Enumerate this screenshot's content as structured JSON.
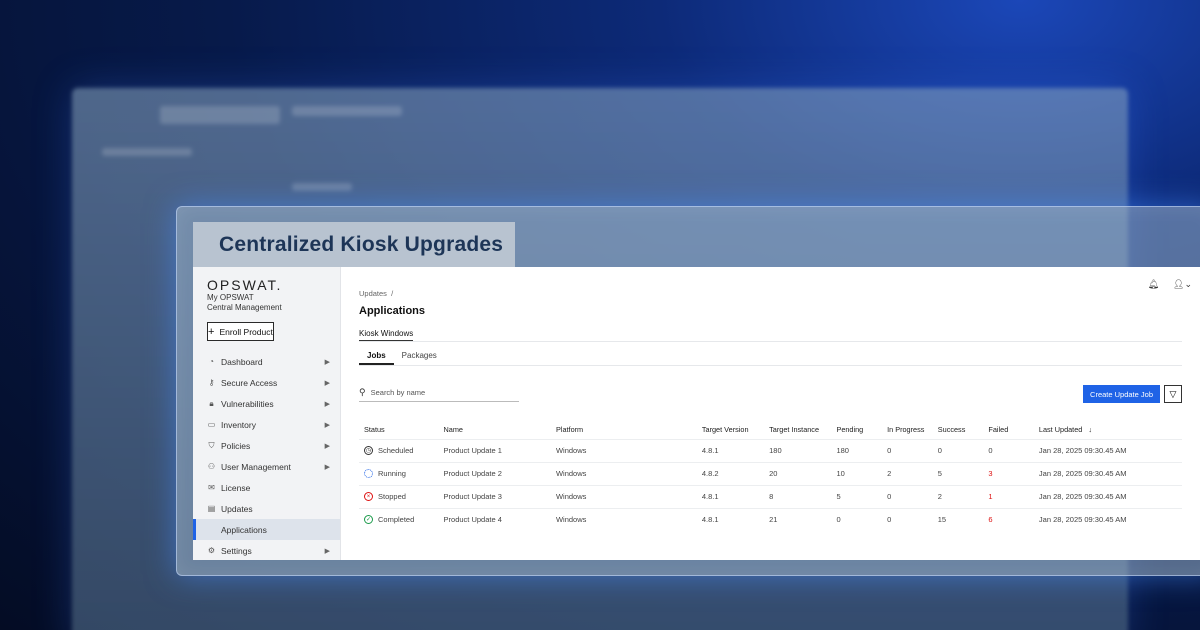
{
  "title": "Centralized Kiosk Upgrades",
  "sidebar": {
    "logo": "OPSWAT.",
    "subtitle_line1": "My OPSWAT",
    "subtitle_line2": "Central Management",
    "enroll_label": "Enroll Product",
    "items": [
      {
        "label": "Dashboard",
        "icon": "dashboard-icon",
        "chevron": true
      },
      {
        "label": "Secure Access",
        "icon": "key-icon",
        "chevron": true
      },
      {
        "label": "Vulnerabilities",
        "icon": "lock-icon",
        "chevron": true
      },
      {
        "label": "Inventory",
        "icon": "monitor-icon",
        "chevron": true
      },
      {
        "label": "Policies",
        "icon": "shield-icon",
        "chevron": true
      },
      {
        "label": "User Management",
        "icon": "users-icon",
        "chevron": true
      },
      {
        "label": "License",
        "icon": "license-icon",
        "chevron": false
      },
      {
        "label": "Updates",
        "icon": "updates-icon",
        "chevron": false
      },
      {
        "label": "Applications",
        "icon": "",
        "chevron": false,
        "active": true
      },
      {
        "label": "Settings",
        "icon": "gear-icon",
        "chevron": true
      }
    ]
  },
  "main": {
    "breadcrumb": "Updates",
    "breadcrumb_sep": "/",
    "page_title": "Applications",
    "kiosk_tab": "Kiosk Windows",
    "tabs": [
      "Jobs",
      "Packages"
    ],
    "search_placeholder": "Search by name",
    "create_button": "Create Update Job",
    "columns": [
      "Status",
      "Name",
      "Platform",
      "Target Version",
      "Target Instance",
      "Pending",
      "In Progress",
      "Success",
      "Failed",
      "Last Updated"
    ],
    "sort_indicator": "↓",
    "rows": [
      {
        "status": "Scheduled",
        "kind": "sched",
        "name": "Product Update 1",
        "platform": "Windows",
        "version": "4.8.1",
        "instance": "180",
        "pending": "180",
        "in_progress": "0",
        "success": "0",
        "failed": "0",
        "failed_alert": false,
        "updated": "Jan 28, 2025 09:30.45 AM"
      },
      {
        "status": "Running",
        "kind": "run",
        "name": "Product Update 2",
        "platform": "Windows",
        "version": "4.8.2",
        "instance": "20",
        "pending": "10",
        "in_progress": "2",
        "success": "5",
        "failed": "3",
        "failed_alert": true,
        "updated": "Jan 28, 2025 09:30.45 AM"
      },
      {
        "status": "Stopped",
        "kind": "stop",
        "name": "Product Update 3",
        "platform": "Windows",
        "version": "4.8.1",
        "instance": "8",
        "pending": "5",
        "in_progress": "0",
        "success": "2",
        "failed": "1",
        "failed_alert": true,
        "updated": "Jan 28, 2025 09:30.45 AM"
      },
      {
        "status": "Completed",
        "kind": "done",
        "name": "Product Update 4",
        "platform": "Windows",
        "version": "4.8.1",
        "instance": "21",
        "pending": "0",
        "in_progress": "0",
        "success": "15",
        "failed": "6",
        "failed_alert": true,
        "updated": "Jan 28, 2025 09:30.45 AM"
      }
    ]
  },
  "colors": {
    "accent": "#1f63e6",
    "failed": "#dd1111",
    "completed": "#1a9a4a",
    "title": "#1d3557"
  }
}
